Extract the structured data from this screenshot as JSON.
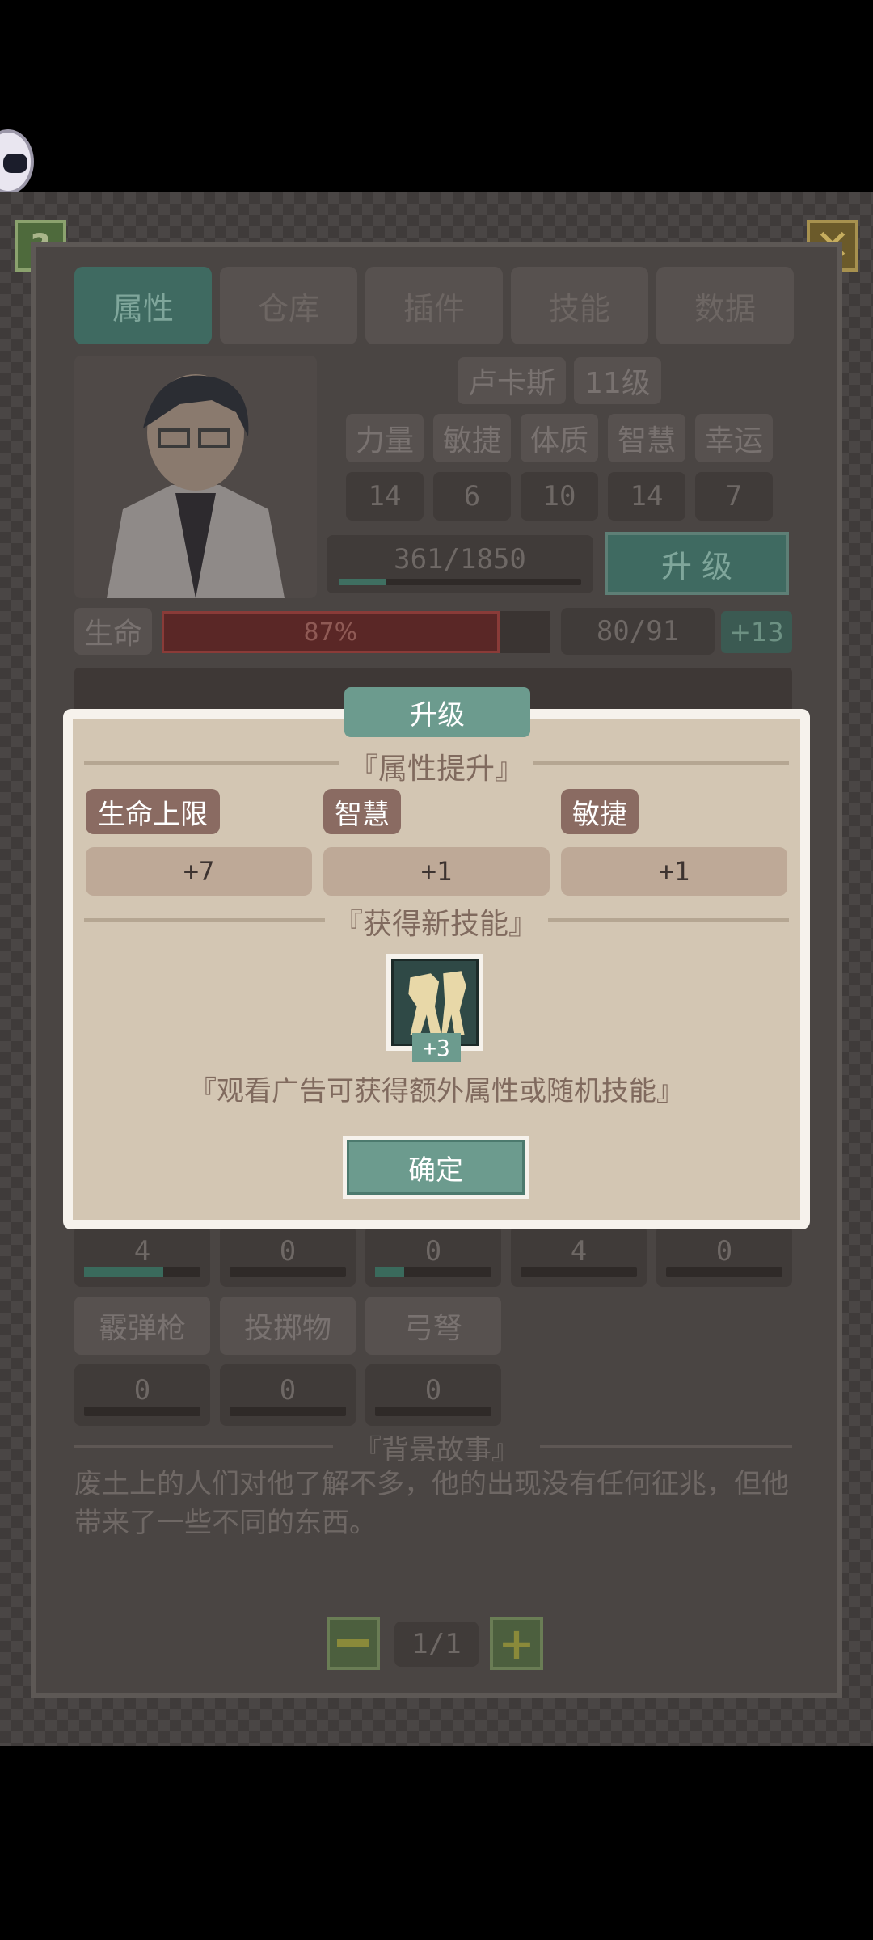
{
  "tabs": [
    "属性",
    "仓库",
    "插件",
    "技能",
    "数据"
  ],
  "character": {
    "name": "卢卡斯",
    "level": "11级"
  },
  "attributes": {
    "labels": [
      "力量",
      "敏捷",
      "体质",
      "智慧",
      "幸运"
    ],
    "values": [
      "14",
      "6",
      "10",
      "14",
      "7"
    ]
  },
  "exp": {
    "text": "361/1850",
    "fraction": 0.195
  },
  "upgrade_label": "升 级",
  "hp": {
    "label": "生命",
    "percent_text": "87%",
    "fraction": 0.87,
    "value": "80/91",
    "bonus": "+13"
  },
  "weapons_row1": {
    "values": [
      "4",
      "0",
      "0",
      "4",
      "0"
    ],
    "fractions": [
      0.68,
      0,
      0.25,
      0,
      0
    ]
  },
  "weapons_row2": {
    "labels": [
      "霰弹枪",
      "投掷物",
      "弓弩"
    ],
    "values": [
      "0",
      "0",
      "0"
    ]
  },
  "background": {
    "title": "『背景故事』",
    "text": "废土上的人们对他了解不多，他的出现没有任何征兆，但他带来了一些不同的东西。"
  },
  "pager": {
    "text": "1/1"
  },
  "dialog": {
    "title": "升级",
    "attr_section": "『属性提升』",
    "attrs": [
      {
        "label": "生命上限",
        "value": "+7"
      },
      {
        "label": "智慧",
        "value": "+1"
      },
      {
        "label": "敏捷",
        "value": "+1"
      }
    ],
    "skill_section": "『获得新技能』",
    "skill_badge": "+3",
    "ad_text": "『观看广告可获得额外属性或随机技能』",
    "confirm": "确定"
  },
  "colors": {
    "accent": "#6c9b8e",
    "hp_bar": "#8e3030",
    "dialog_bg": "#d3c6b3"
  }
}
